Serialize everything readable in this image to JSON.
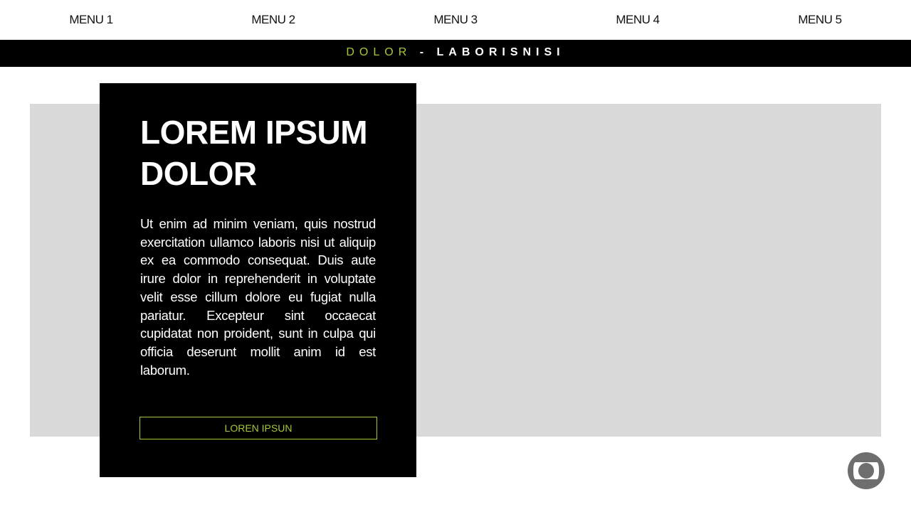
{
  "nav": {
    "items": [
      {
        "label": "MENU 1"
      },
      {
        "label": "MENU 2"
      },
      {
        "label": "MENU 3"
      },
      {
        "label": "MENU 4"
      },
      {
        "label": "MENU 5"
      }
    ]
  },
  "banner": {
    "highlight": "DOLOR",
    "separator": " - ",
    "text": "LABORISNISI",
    "accent_color": "#a6c935"
  },
  "card": {
    "title": "LOREM IPSUM DOLOR",
    "body": "Ut enim ad minim veniam, quis nostrud exercitation ullamco laboris nisi ut aliquip ex ea commodo consequat. Duis aute irure dolor in reprehenderit in voluptate velit esse cillum dolore eu fugiat nulla pariatur. Excepteur sint occaecat cupidatat non proident, sunt in culpa qui officia deserunt mollit anim id est laborum.",
    "button_label": "LOREN IPSUN"
  },
  "logo": {
    "icon": "globo-logo-icon"
  }
}
